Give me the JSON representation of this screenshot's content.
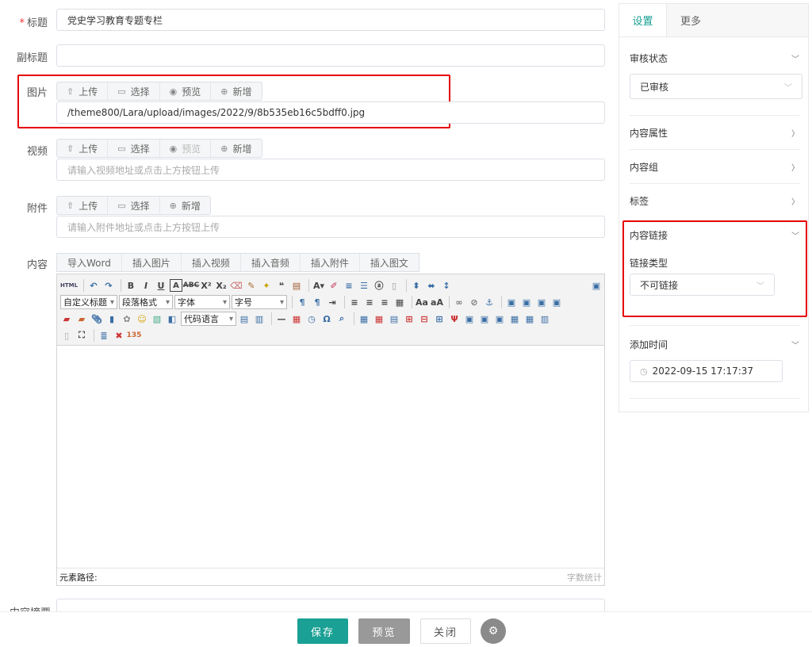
{
  "form": {
    "title_label": "标题",
    "title_required": "*",
    "title_value": "党史学习教育专题专栏",
    "subtitle_label": "副标题",
    "subtitle_value": "",
    "image_label": "图片",
    "image_buttons": [
      "上传",
      "选择",
      "预览",
      "新增"
    ],
    "image_value": "/theme800/Lara/upload/images/2022/9/8b535eb16c5bdff0.jpg",
    "video_label": "视频",
    "video_buttons": [
      "上传",
      "选择",
      "预览",
      "新增"
    ],
    "video_placeholder": "请输入视频地址或点击上方按钮上传",
    "attachment_label": "附件",
    "attachment_buttons": [
      "上传",
      "选择",
      "新增"
    ],
    "attachment_placeholder": "请输入附件地址或点击上方按钮上传",
    "content_label": "内容",
    "content_tabs": [
      "导入Word",
      "插入图片",
      "插入视频",
      "插入音频",
      "插入附件",
      "插入图文"
    ],
    "summary_label": "内容摘要"
  },
  "editor": {
    "selects": [
      "自定义标题",
      "段落格式",
      "字体",
      "字号",
      "代码语言"
    ],
    "element_path_label": "元素路径:",
    "word_count_label": "字数统计"
  },
  "sidebar": {
    "tabs": [
      "设置",
      "更多"
    ],
    "review_status_label": "审核状态",
    "review_status_value": "已审核",
    "content_attr_label": "内容属性",
    "content_group_label": "内容组",
    "tags_label": "标签",
    "content_link_label": "内容链接",
    "link_type_label": "链接类型",
    "link_type_value": "不可链接",
    "add_time_label": "添加时间",
    "add_time_value": "2022-09-15 17:17:37"
  },
  "actions": {
    "save": "保存",
    "preview": "预览",
    "close": "关闭"
  },
  "colors": {
    "accent": "#1aa094",
    "highlight_box": "#e60000",
    "preview_button": "#999999"
  }
}
